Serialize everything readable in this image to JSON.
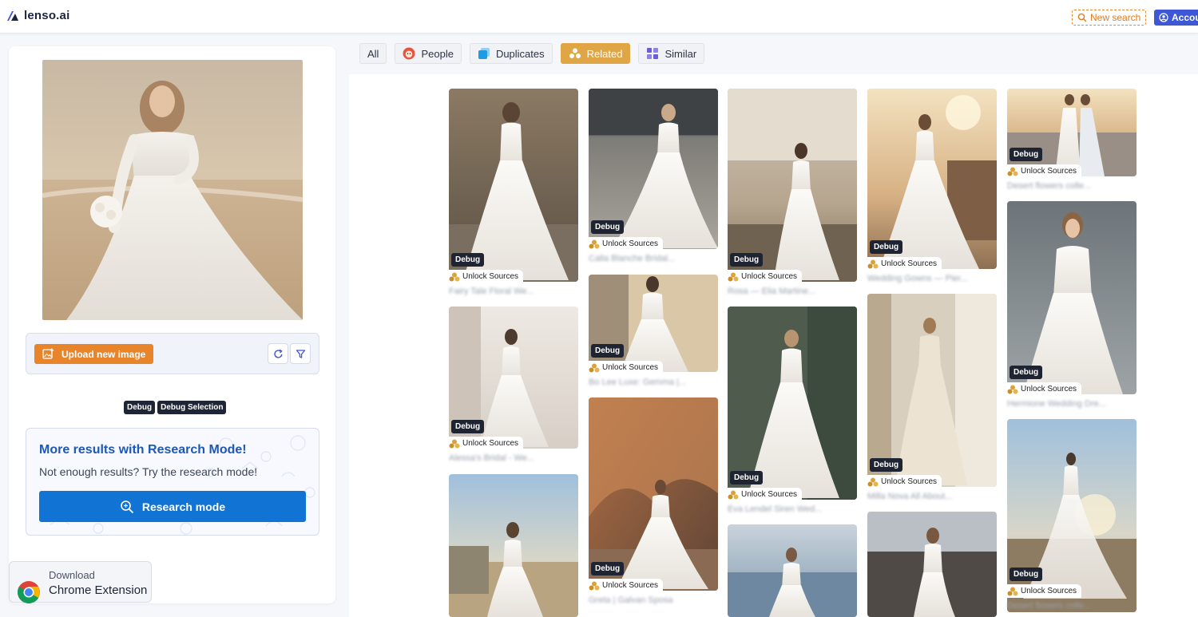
{
  "header": {
    "logo_text": "lenso.ai",
    "new_search_label": "New search",
    "account_label": "Accou"
  },
  "left_panel": {
    "upload_label": "Upload new image",
    "debug_tags": [
      "Debug",
      "Debug Selection"
    ],
    "research": {
      "title": "More results with Research Mode!",
      "subtitle": "Not enough results? Try the research mode!",
      "button_label": "Research mode"
    },
    "chrome_extension": {
      "line1": "Download",
      "line2": "Chrome Extension"
    }
  },
  "tabs": [
    {
      "label": "All",
      "active": false
    },
    {
      "label": "People",
      "active": false
    },
    {
      "label": "Duplicates",
      "active": false
    },
    {
      "label": "Related",
      "active": true
    },
    {
      "label": "Similar",
      "active": false
    }
  ],
  "results": {
    "badge_label": "Debug",
    "unlock_label": "Unlock Sources",
    "cards": [
      {
        "caption": "Fairy Tale Floral We..."
      },
      {
        "caption": "Alessa's Bridal - We..."
      },
      {
        "caption": ""
      },
      {
        "caption": "Calla Blanche Bridal..."
      },
      {
        "caption": "Bo Lee Luxe: Gemma |..."
      },
      {
        "caption": "Greta | Galvan Sposa"
      },
      {
        "caption": "Rosa — Elia Martine..."
      },
      {
        "caption": "Eva Lendel Siren Wed..."
      },
      {
        "caption": ""
      },
      {
        "caption": "Wedding Gowns — Pier..."
      },
      {
        "caption": "Milla Nova All About..."
      },
      {
        "caption": ""
      },
      {
        "caption": "Desert flowers colle..."
      },
      {
        "caption": "Hermione Wedding Dre..."
      },
      {
        "caption": "Desert flowers colle..."
      }
    ]
  },
  "colors": {
    "accent_orange": "#e8852a",
    "related_gold": "#e0a545",
    "research_blue": "#1174d4",
    "account_blue": "#3e57d4"
  }
}
